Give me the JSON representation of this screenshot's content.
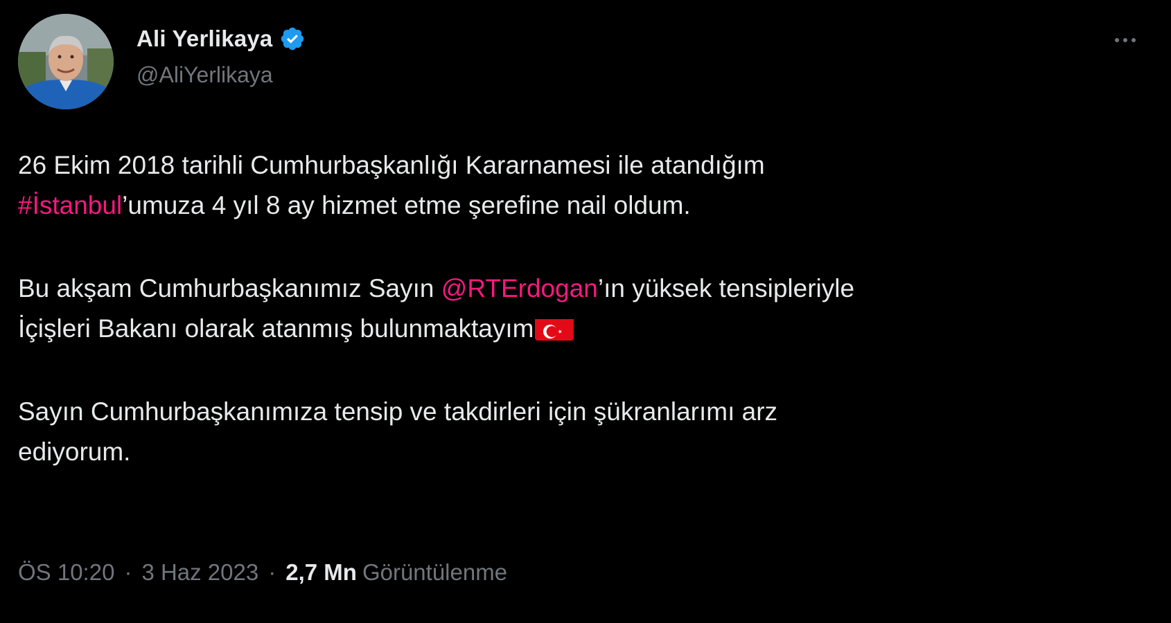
{
  "author": {
    "name": "Ali Yerlikaya",
    "handle": "@AliYerlikaya",
    "verified_icon": "verified-badge-icon",
    "avatar": "avatar-photo"
  },
  "more_icon": "more-options-icon",
  "tweet": {
    "p1": {
      "line1": "26 Ekim 2018 tarihli Cumhurbaşkanlığı Kararnamesi ile atandığım",
      "hashtag": "#İstanbul",
      "after_hashtag": "’umuza 4 yıl 8 ay hizmet etme şerefine nail oldum."
    },
    "p2": {
      "before_mention": "Bu akşam Cumhurbaşkanımız Sayın ",
      "mention": "@RTErdogan",
      "after_mention": "’ın yüksek tensipleriyle",
      "line2": "İçişleri Bakanı olarak atanmış bulunmaktayım",
      "flag_icon": "turkey-flag-icon"
    },
    "p3": {
      "line1": "Sayın Cumhurbaşkanımıza tensip ve takdirleri için şükranlarımı arz",
      "line2": "ediyorum."
    }
  },
  "meta": {
    "time": "ÖS 10:20",
    "separator": "·",
    "date": "3 Haz 2023",
    "views_count": "2,7 Mn",
    "views_label": "Görüntülenme"
  },
  "colors": {
    "background": "#000000",
    "text": "#e7e9ea",
    "muted": "#71767b",
    "link": "#f91880",
    "verified": "#1d9bf0"
  }
}
